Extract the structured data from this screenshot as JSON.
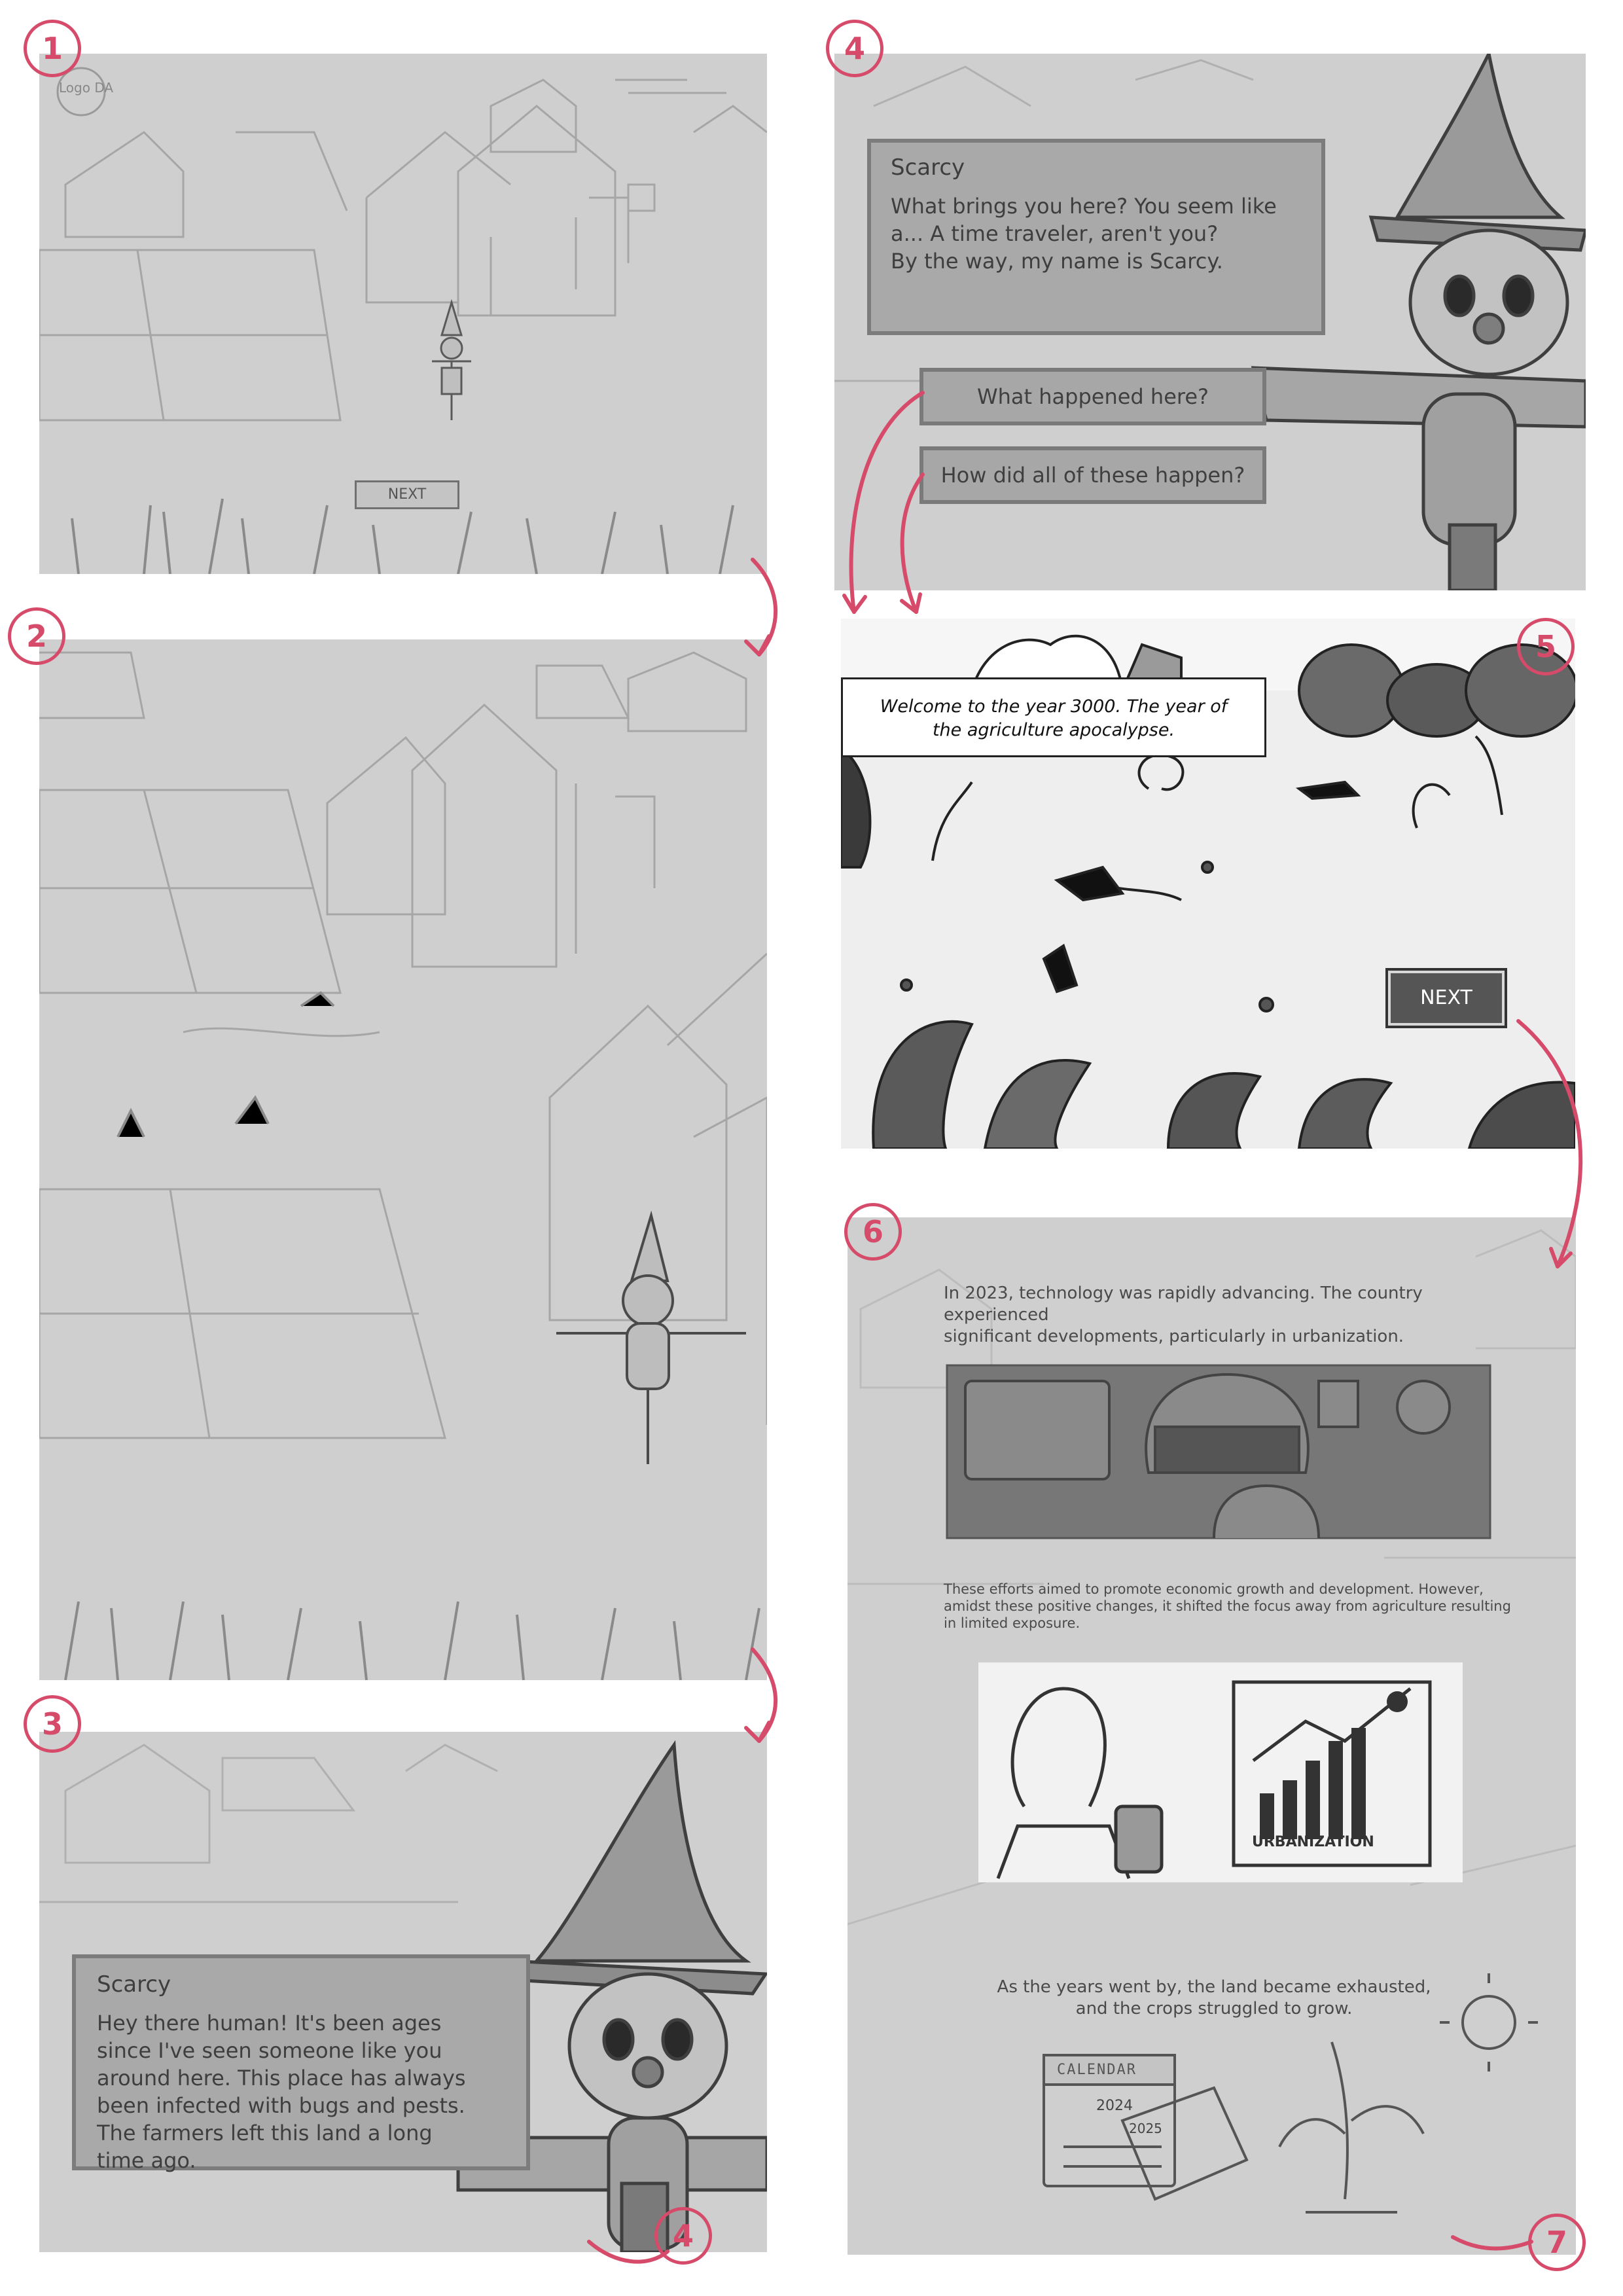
{
  "steps": {
    "s1": "1",
    "s2": "2",
    "s3": "3",
    "s4": "4",
    "s5": "5",
    "s6": "6",
    "s3_end": "4",
    "s6_end": "7"
  },
  "panel1": {
    "logo": "Logo DA",
    "next_label": "NEXT"
  },
  "panel3": {
    "speaker": "Scarcy",
    "dialog": "Hey there human! It's been ages\nsince I've seen someone like you\naround here. This place has always\nbeen infected with bugs and pests.\nThe farmers left this land a long\ntime ago."
  },
  "panel4": {
    "speaker": "Scarcy",
    "dialog": "What brings you here? You seem like\na... A time traveler, aren't you?\nBy the way, my name is Scarcy.",
    "choices": [
      "What happened here?",
      "How did all of these happen?"
    ]
  },
  "panel5": {
    "caption": "Welcome to the year 3000. The year of\nthe agriculture apocalypse.",
    "next_label": "NEXT"
  },
  "panel6": {
    "para1": "In 2023, technology was rapidly advancing. The country experienced\nsignificant developments, particularly in urbanization.",
    "para2": "These efforts aimed to promote economic growth and development. However,\namidst these positive changes, it shifted the focus away from agriculture resulting\nin limited exposure.",
    "chart_label": "URBANIZATION",
    "para3": "As the years went by, the land became exhausted,\nand the crops struggled to grow.",
    "calendar_label": "CALENDAR",
    "years": [
      "2024",
      "2025"
    ]
  },
  "colors": {
    "accent": "#d64a6a",
    "panel_bg": "#cfcfcf",
    "dialog_bg": "#a9a9a9"
  }
}
